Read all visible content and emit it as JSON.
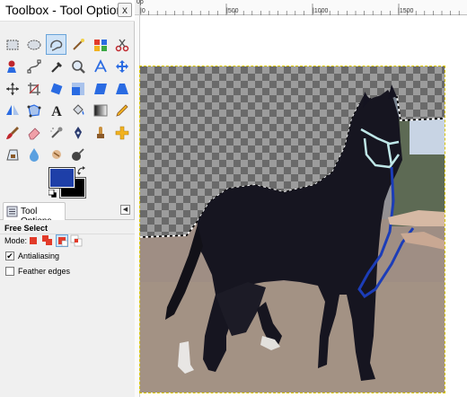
{
  "window": {
    "title": "Toolbox - Tool Options",
    "close_label": "x"
  },
  "tools": [
    {
      "name": "rect-select-icon"
    },
    {
      "name": "ellipse-select-icon"
    },
    {
      "name": "free-select-icon",
      "active": true
    },
    {
      "name": "fuzzy-select-icon"
    },
    {
      "name": "color-select-icon"
    },
    {
      "name": "scissors-select-icon"
    },
    {
      "name": "foreground-select-icon"
    },
    {
      "name": "paths-icon"
    },
    {
      "name": "color-picker-icon"
    },
    {
      "name": "zoom-icon"
    },
    {
      "name": "measure-icon"
    },
    {
      "name": "move-icon"
    },
    {
      "name": "align-icon"
    },
    {
      "name": "crop-icon"
    },
    {
      "name": "rotate-icon"
    },
    {
      "name": "scale-icon"
    },
    {
      "name": "shear-icon"
    },
    {
      "name": "perspective-icon"
    },
    {
      "name": "flip-icon"
    },
    {
      "name": "cage-transform-icon"
    },
    {
      "name": "text-icon"
    },
    {
      "name": "bucket-fill-icon"
    },
    {
      "name": "blend-icon"
    },
    {
      "name": "pencil-icon"
    },
    {
      "name": "paintbrush-icon"
    },
    {
      "name": "eraser-icon"
    },
    {
      "name": "airbrush-icon"
    },
    {
      "name": "ink-icon"
    },
    {
      "name": "clone-icon"
    },
    {
      "name": "heal-icon"
    },
    {
      "name": "perspective-clone-icon"
    },
    {
      "name": "blur-icon"
    },
    {
      "name": "smudge-icon"
    },
    {
      "name": "dodge-burn-icon"
    }
  ],
  "colors": {
    "foreground": "#1e3fa8",
    "background": "#000000",
    "selection_marquee": "#d8c400"
  },
  "tab": {
    "label": "Tool Options"
  },
  "options": {
    "title": "Free Select",
    "mode_label": "Mode:",
    "mode_active_index": 2,
    "antialiasing_label": "Antialiasing",
    "antialiasing_checked": true,
    "feather_label": "Feather edges",
    "feather_checked": false
  },
  "ruler": {
    "corner_label": "0p",
    "labels": [
      "|0",
      "|500",
      "|1000",
      "|1500"
    ]
  }
}
